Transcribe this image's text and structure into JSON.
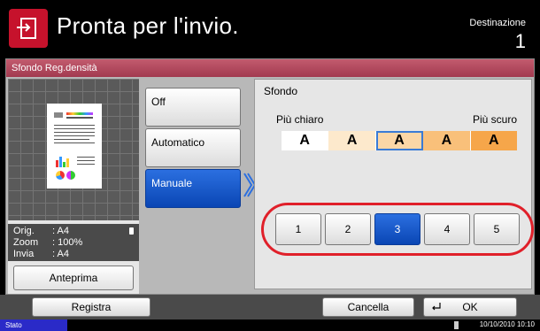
{
  "header": {
    "status_title": "Pronta per l'invio.",
    "destination_label": "Destinazione",
    "destination_count": "1"
  },
  "panel": {
    "title": "Sfondo Reg.densità"
  },
  "preview": {
    "info": [
      {
        "key": "Orig.",
        "value": ": A4"
      },
      {
        "key": "Zoom",
        "value": ": 100%"
      },
      {
        "key": "Invia",
        "value": ": A4"
      }
    ],
    "preview_button": "Anteprima"
  },
  "options": {
    "off": "Off",
    "auto": "Automatico",
    "manual": "Manuale",
    "selected": "Manuale"
  },
  "sfondo": {
    "label": "Sfondo",
    "lighter": "Più chiaro",
    "darker": "Più scuro",
    "sample_letter": "A",
    "sample_colors": [
      "#ffffff",
      "#fde9cc",
      "#fbd6a6",
      "#f9c07a",
      "#f6a64a"
    ],
    "levels": [
      "1",
      "2",
      "3",
      "4",
      "5"
    ],
    "selected_level": "3"
  },
  "footer": {
    "register": "Registra",
    "cancel": "Cancella",
    "ok": "OK"
  },
  "status_bar": {
    "stato": "Stato",
    "datetime": "10/10/2010  10:10"
  },
  "colors": {
    "accent_red": "#c6122c",
    "selected_blue": "#0a46b4",
    "highlight_ring": "#e0202a"
  }
}
